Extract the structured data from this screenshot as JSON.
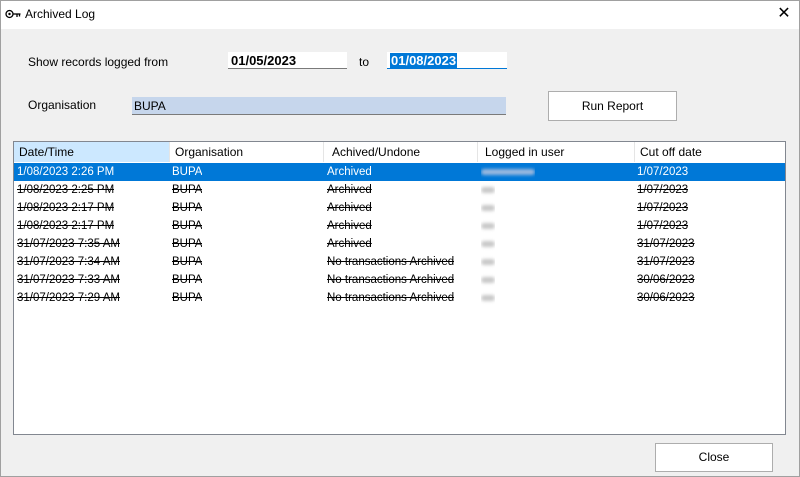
{
  "window": {
    "title": "Archived Log",
    "icon": "key-icon"
  },
  "filter": {
    "from_label": "Show records logged from",
    "from_value": "01/05/2023",
    "to_label": "to",
    "to_value": "01/08/2023",
    "org_label": "Organisation",
    "org_value": "BUPA"
  },
  "buttons": {
    "run_report": "Run Report",
    "close": "Close"
  },
  "table": {
    "columns": [
      "Date/Time",
      "Organisation",
      "Achived/Undone",
      "Logged in user",
      "Cut off date"
    ],
    "rows": [
      {
        "datetime": "1/08/2023 2:26 PM",
        "org": "BUPA",
        "status": "Archived",
        "user": "",
        "cutoff": "1/07/2023"
      },
      {
        "datetime": "1/08/2023 2:25 PM",
        "org": "BUPA",
        "status": "Archived",
        "user": "",
        "cutoff": "1/07/2023"
      },
      {
        "datetime": "1/08/2023 2:17 PM",
        "org": "BUPA",
        "status": "Archived",
        "user": "",
        "cutoff": "1/07/2023"
      },
      {
        "datetime": "1/08/2023 2:17 PM",
        "org": "BUPA",
        "status": "Archived",
        "user": "",
        "cutoff": "1/07/2023"
      },
      {
        "datetime": "31/07/2023 7:35 AM",
        "org": "BUPA",
        "status": "Archived",
        "user": "",
        "cutoff": "31/07/2023"
      },
      {
        "datetime": "31/07/2023 7:34 AM",
        "org": "BUPA",
        "status": "No transactions Archived",
        "user": "",
        "cutoff": "31/07/2023"
      },
      {
        "datetime": "31/07/2023 7:33 AM",
        "org": "BUPA",
        "status": "No transactions Archived",
        "user": "",
        "cutoff": "30/06/2023"
      },
      {
        "datetime": "31/07/2023 7:29 AM",
        "org": "BUPA",
        "status": "No transactions Archived",
        "user": "",
        "cutoff": "30/06/2023"
      }
    ]
  },
  "colors": {
    "selection": "#0078d7",
    "sorted_header": "#cce8ff",
    "org_field": "#c6d6ec"
  }
}
